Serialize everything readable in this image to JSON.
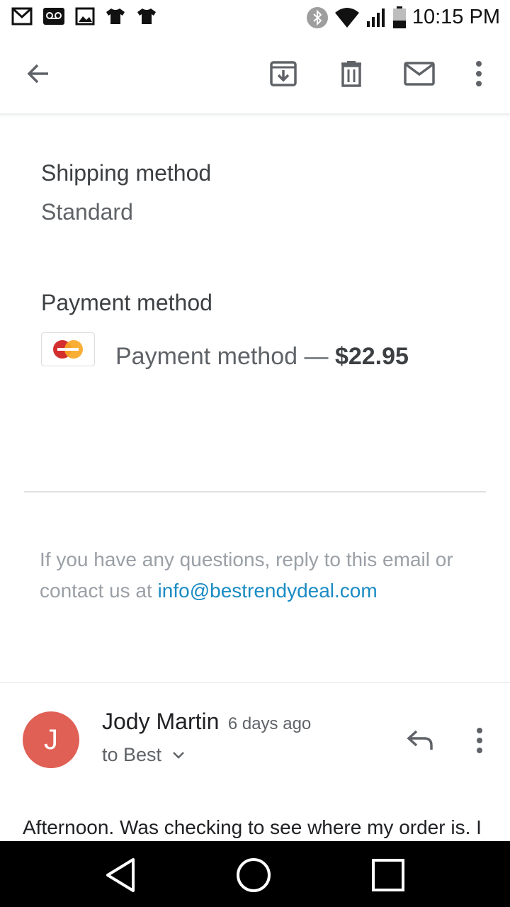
{
  "status_bar": {
    "time": "10:15 PM",
    "left_icons": [
      "gmail-icon",
      "voicemail-icon",
      "image-icon",
      "shirt-icon",
      "shirt-icon"
    ],
    "right_icons": [
      "bluetooth-icon",
      "wifi-icon",
      "signal-icon",
      "battery-icon"
    ]
  },
  "toolbar": {
    "icons": [
      "back-arrow-icon",
      "archive-icon",
      "delete-icon",
      "mark-unread-icon",
      "more-vert-icon"
    ]
  },
  "shipping": {
    "title": "Shipping method",
    "value": "Standard"
  },
  "payment": {
    "title": "Payment method",
    "label": "Payment method —",
    "amount": "$22.95",
    "card_icon": "mastercard-icon"
  },
  "contact": {
    "text": "If you have any questions, reply to this email or contact us at",
    "email": "info@bestrendydeal.com"
  },
  "message": {
    "avatar_initial": "J",
    "sender_name": "Jody Martin",
    "time": "6 days ago",
    "recipient": "to Best",
    "body": "Afternoon. Was checking to see where my order is. I"
  },
  "nav_bar": {
    "icons": [
      "back-triangle-icon",
      "home-circle-icon",
      "recents-square-icon"
    ]
  },
  "colors": {
    "link": "#1a8bc4",
    "avatar": "#e06055",
    "nav_bar": "#000000"
  }
}
